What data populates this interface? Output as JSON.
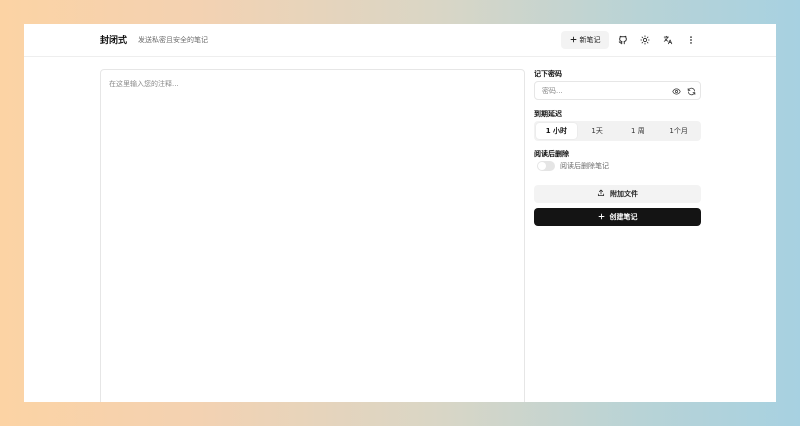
{
  "header": {
    "brand": "封闭式",
    "tagline": "发送私密且安全的笔记",
    "new_note_label": "新笔记"
  },
  "editor": {
    "placeholder": "在这里输入您的注释..."
  },
  "password": {
    "label": "记下密码",
    "placeholder": "密码..."
  },
  "expiry": {
    "label": "到期延迟",
    "options": [
      "1 小时",
      "1天",
      "1 周",
      "1个月"
    ],
    "selected": "1 小时"
  },
  "delete_after_read": {
    "label": "阅读后删除",
    "toggle_text": "阅读后删除笔记",
    "enabled": false
  },
  "actions": {
    "attach_label": "附加文件",
    "create_label": "创建笔记"
  },
  "icons": [
    "plus-icon",
    "github-icon",
    "sun-icon",
    "translate-icon",
    "more-vertical-icon",
    "eye-icon",
    "refresh-icon",
    "upload-icon"
  ]
}
